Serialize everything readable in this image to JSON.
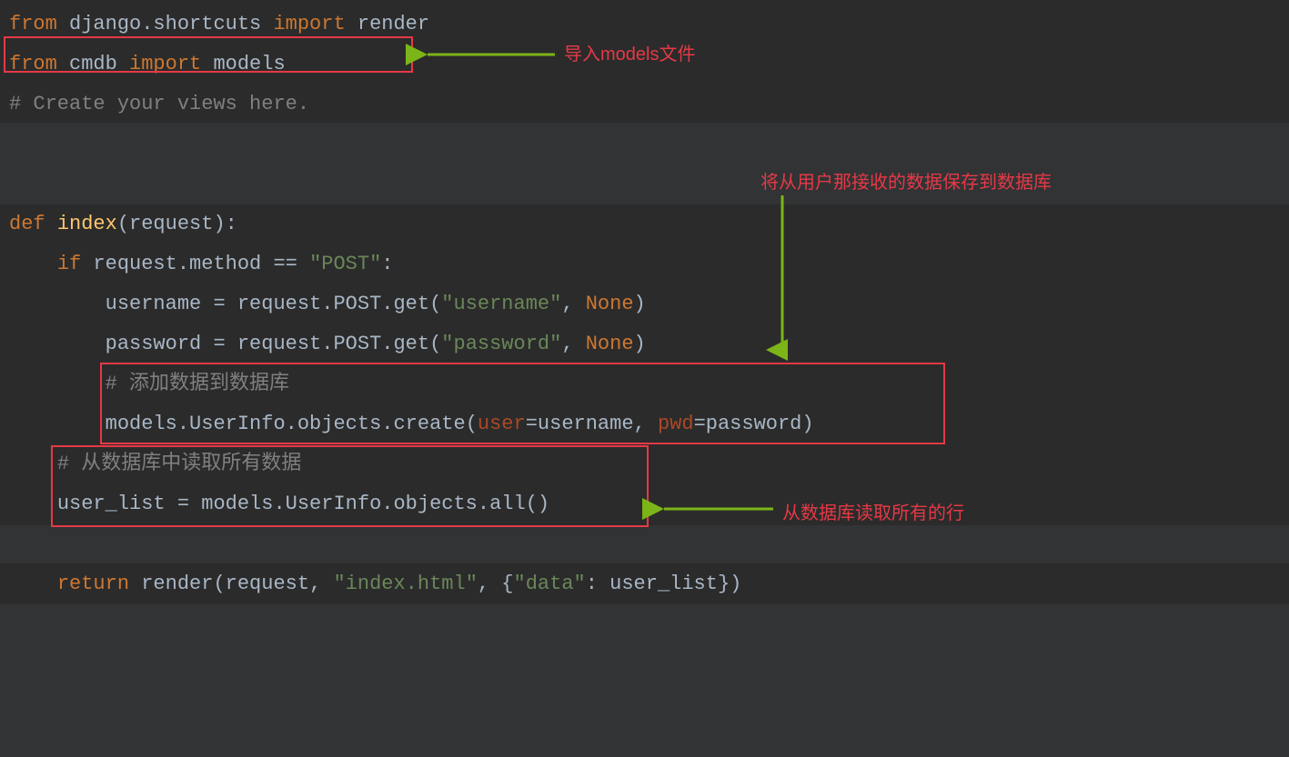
{
  "code": {
    "line1": {
      "kw1": "from",
      "mod1": " django.shortcuts ",
      "kw2": "import",
      "mod2": " render"
    },
    "line2": {
      "kw1": "from",
      "mod1": " cmdb ",
      "kw2": "import",
      "mod2": " models"
    },
    "line3": "# Create your views here.",
    "line6": {
      "kw": "def ",
      "fn": "index",
      "rest": "(request):"
    },
    "line7": {
      "indent": "    ",
      "kw": "if",
      "rest1": " request.method == ",
      "str": "\"POST\"",
      "rest2": ":"
    },
    "line8": {
      "indent": "        ",
      "rest1": "username = request.POST.get(",
      "str": "\"username\"",
      "comma": ", ",
      "none": "None",
      "rest2": ")"
    },
    "line9": {
      "indent": "        ",
      "rest1": "password = request.POST.get(",
      "str": "\"password\"",
      "comma": ", ",
      "none": "None",
      "rest2": ")"
    },
    "line10": {
      "indent": "        ",
      "comment": "# 添加数据到数据库"
    },
    "line11": {
      "indent": "        ",
      "rest1": "models.UserInfo.objects.create(",
      "p1": "user",
      "eq1": "=username, ",
      "p2": "pwd",
      "eq2": "=password)"
    },
    "line12": {
      "indent": "    ",
      "comment": "# 从数据库中读取所有数据"
    },
    "line13": {
      "indent": "    ",
      "rest": "user_list = models.UserInfo.objects.all()"
    },
    "line15": {
      "indent": "    ",
      "kw": "return",
      "rest1": " render(request, ",
      "str1": "\"index.html\"",
      "rest2": ", {",
      "str2": "\"data\"",
      "rest3": ": user_list})"
    }
  },
  "annotations": {
    "a1": "导入models文件",
    "a2": "将从用户那接收的数据保存到数据库",
    "a3": "从数据库读取所有的行"
  }
}
